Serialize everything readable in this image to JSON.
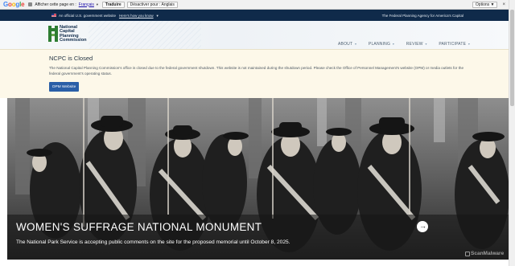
{
  "translate_bar": {
    "logo": "Google",
    "prompt": "Afficher cette page en :",
    "language": "Français",
    "translate_button": "Traduire",
    "disable_button": "Désactiver pour : Anglais",
    "options_button": "Options",
    "close": "×",
    "icon": "translate-page-icon"
  },
  "gov_banner": {
    "text": "An official U.S. government website",
    "link": "Here's how you know",
    "tagline": "The Federal Planning Agency for America's Capital",
    "icon": "us-flag-icon"
  },
  "header": {
    "logo_lines": [
      "National",
      "Capital",
      "Planning",
      "Commission"
    ],
    "nav": [
      "ABOUT",
      "PLANNING",
      "REVIEW",
      "PARTICIPATE"
    ]
  },
  "notice": {
    "title": "NCPC is Closed",
    "text": "The National Capital Planning Commission's office is closed due to the federal government shutdown. This website is not maintained during the shutdown period. Please check the Office of Personnel Management's website (OPM) or media outlets for the federal government's operating status.",
    "button": "OPM Website"
  },
  "hero": {
    "title": "WOMEN'S SUFFRAGE NATIONAL MONUMENT",
    "subtitle": "The National Park Service is accepting public comments on the site for the proposed memorial until October 8, 2025.",
    "arrow_icon": "arrow-right-circle-icon",
    "watermark": "ScanMalware"
  },
  "colors": {
    "gov_bar": "#0f2a4a",
    "notice_bg": "#fdf8e9",
    "button": "#2a5fa7",
    "logo_green": "#2e7d32"
  }
}
